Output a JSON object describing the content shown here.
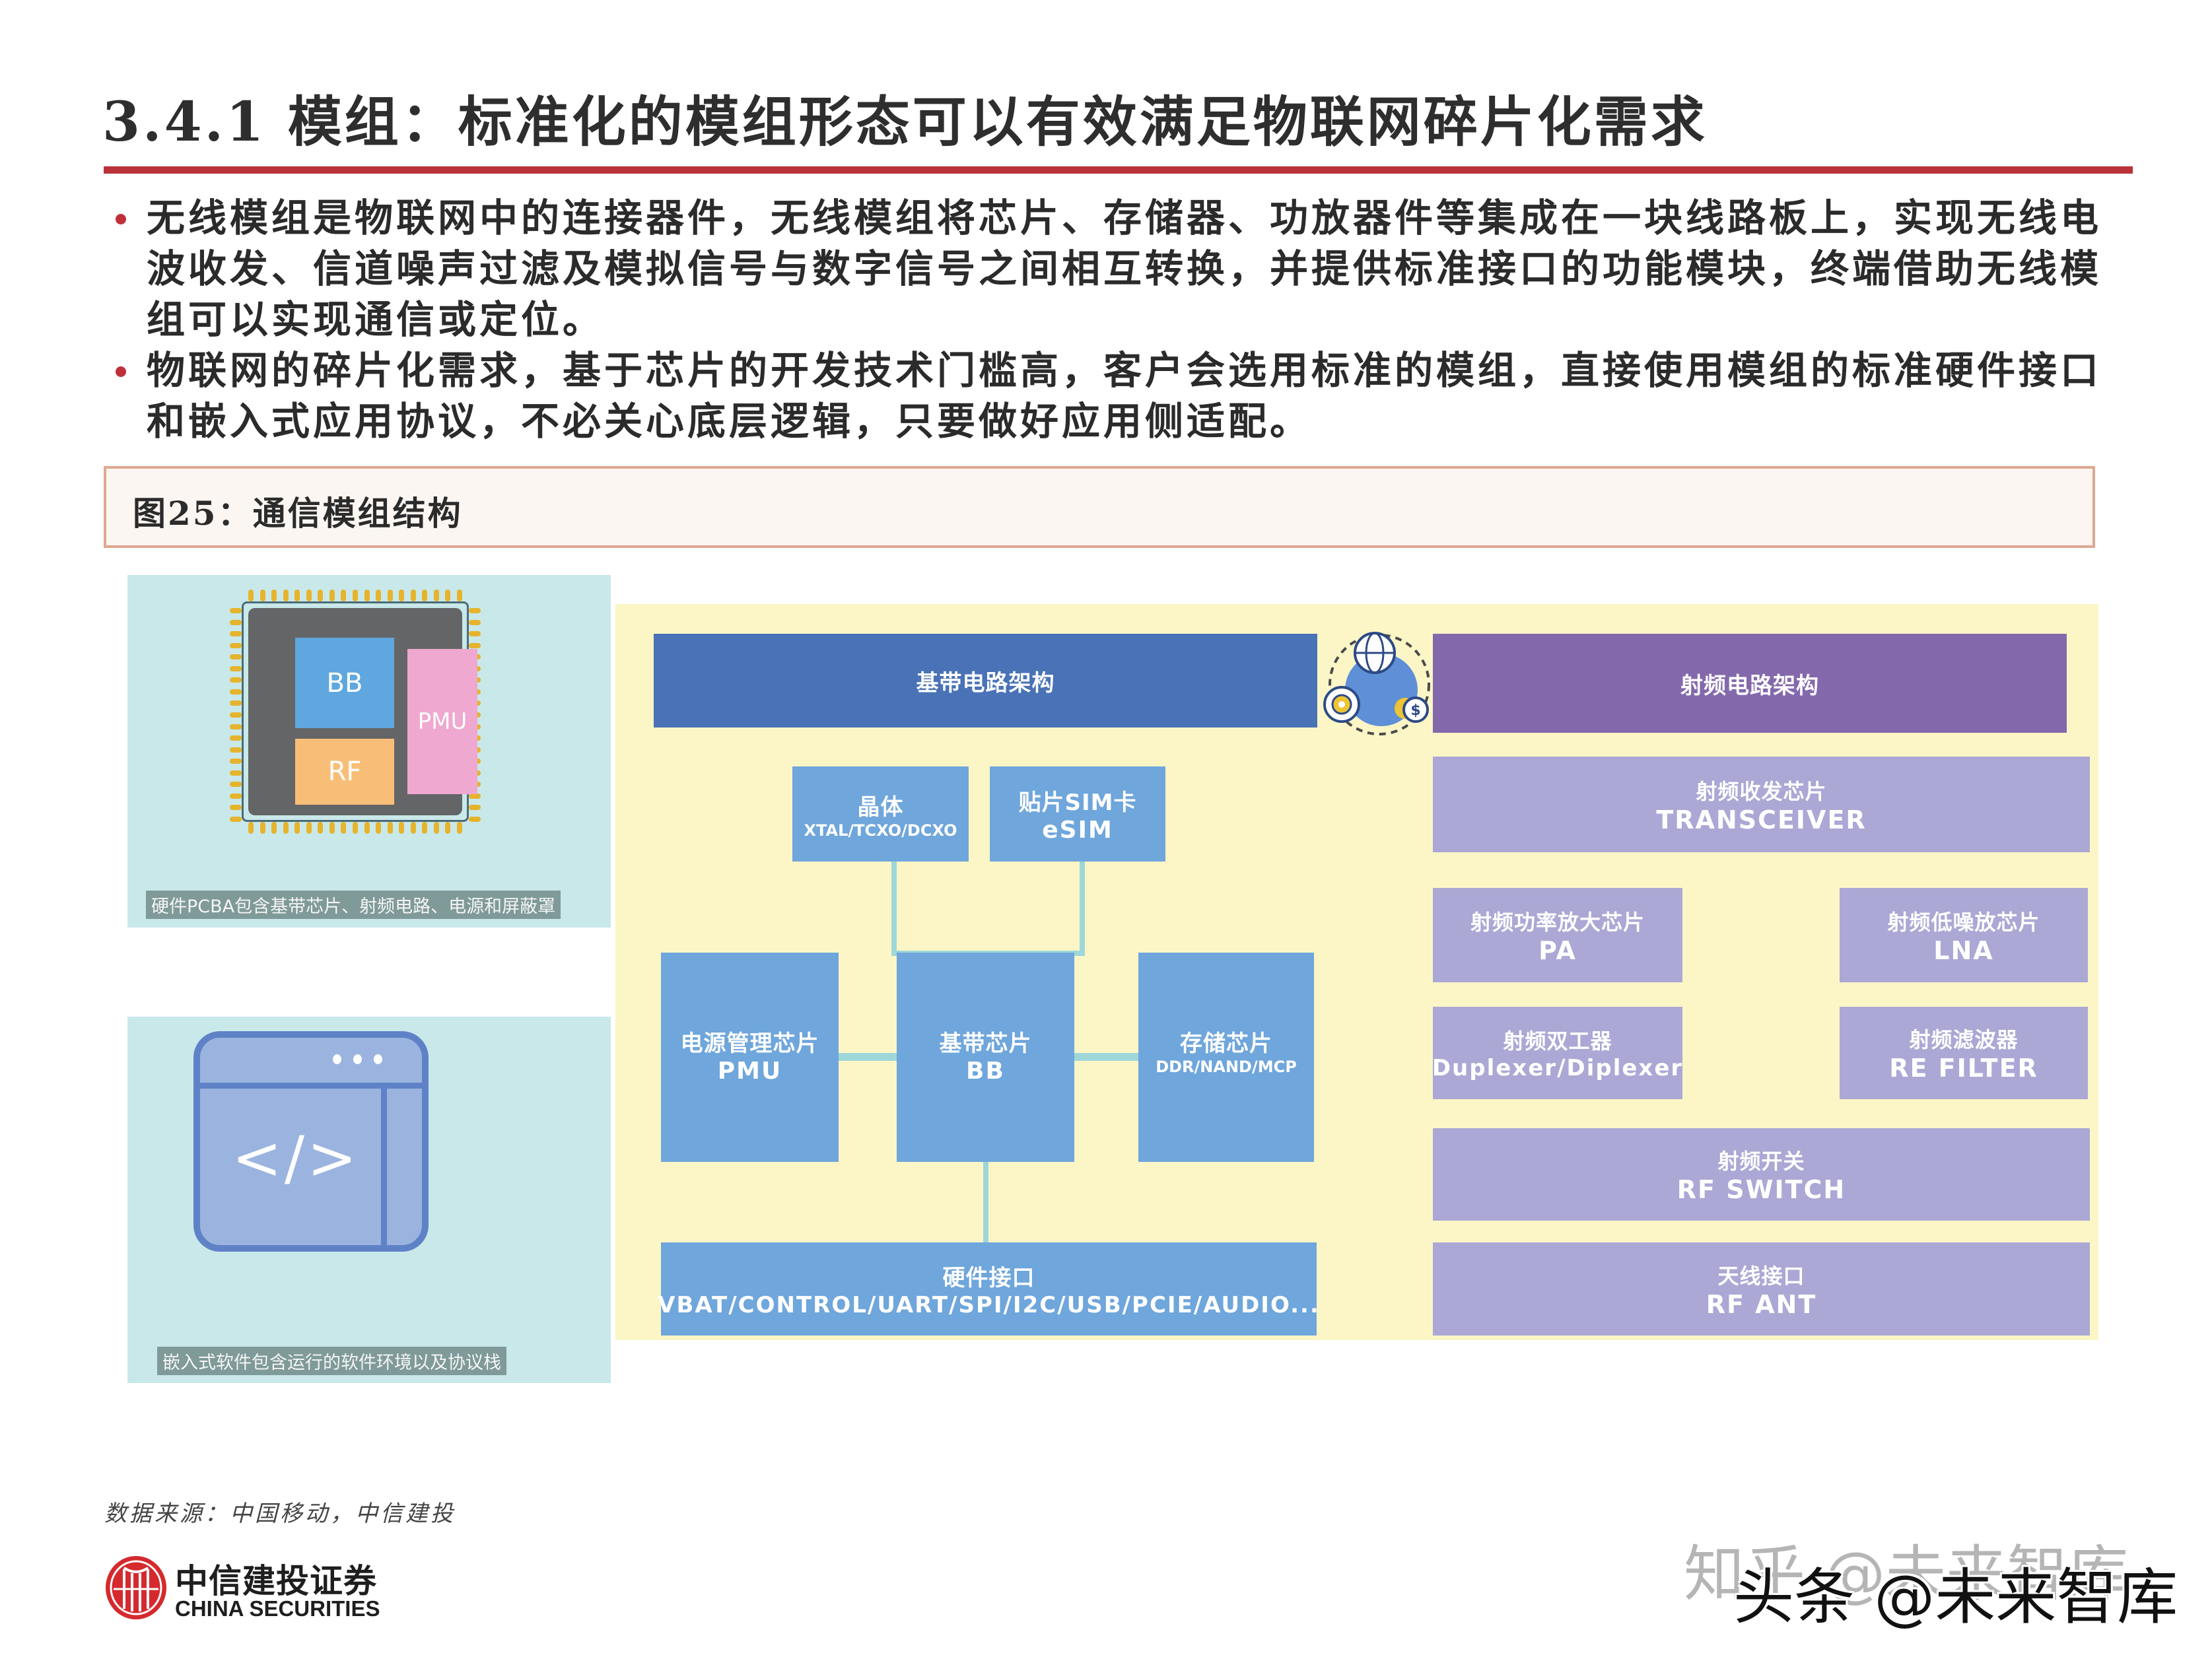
{
  "header": {
    "title": "3.4.1 模组：标准化的模组形态可以有效满足物联网碎片化需求",
    "accent_color": "#b8323a"
  },
  "bullets": [
    "无线模组是物联网中的连接器件，无线模组将芯片、存储器、功放器件等集成在一块线路板上，实现无线电波收发、信道噪声过滤及模拟信号与数字信号之间相互转换，并提供标准接口的功能模块，终端借助无线模组可以实现通信或定位。",
    "物联网的碎片化需求，基于芯片的开发技术门槛高，客户会选用标准的模组，直接使用模组的标准硬件接口和嵌入式应用协议，不必关心底层逻辑，只要做好应用侧适配。"
  ],
  "figure": {
    "caption": "图25：通信模组结构",
    "hardware_panel": {
      "blocks": [
        "BB",
        "RF",
        "PMU"
      ],
      "caption": "硬件PCBA包含基带芯片、射频电路、电源和屏蔽罩"
    },
    "software_panel": {
      "icon": "code-window-icon",
      "glyph": "</>",
      "caption": "嵌入式软件包含运行的软件环境以及协议栈"
    },
    "baseband": {
      "header": "基带电路架构",
      "crystal": {
        "cn": "晶体",
        "en": "XTAL/TCXO/DCXO"
      },
      "esim": {
        "cn": "贴片SIM卡",
        "en": "eSIM"
      },
      "pmu": {
        "cn": "电源管理芯片",
        "en": "PMU"
      },
      "bb": {
        "cn": "基带芯片",
        "en": "BB"
      },
      "storage": {
        "cn": "存储芯片",
        "en": "DDR/NAND/MCP"
      },
      "hw_interface": {
        "cn": "硬件接口",
        "en": "VBAT/CONTROL/UART/SPI/I2C/USB/PCIE/AUDIO..."
      }
    },
    "center_icon": "globe-gear-network-icon",
    "rf": {
      "header": "射频电路架构",
      "transceiver": {
        "cn": "射频收发芯片",
        "en": "TRANSCEIVER"
      },
      "pa": {
        "cn": "射频功率放大芯片",
        "en": "PA"
      },
      "lna": {
        "cn": "射频低噪放芯片",
        "en": "LNA"
      },
      "duplexer": {
        "cn": "射频双工器",
        "en": "Duplexer/Diplexer"
      },
      "filter": {
        "cn": "射频滤波器",
        "en": "RE FILTER"
      },
      "switch": {
        "cn": "射频开关",
        "en": "RF SWITCH"
      },
      "antenna": {
        "cn": "天线接口",
        "en": "RF ANT"
      }
    },
    "colors": {
      "baseband_header": "#4972b7",
      "baseband_block": "#6fa6db",
      "rf_header": "#8369ac",
      "rf_block": "#aba8d5",
      "diagram_bg": "#fcf6c7"
    }
  },
  "footer": {
    "source": "数据来源：中国移动，中信建投",
    "logo_cn": "中信建投证券",
    "logo_en": "CHINA SECURITIES",
    "watermark_1": "知乎 @未来智库",
    "watermark_2": "头条 @未来智库"
  }
}
